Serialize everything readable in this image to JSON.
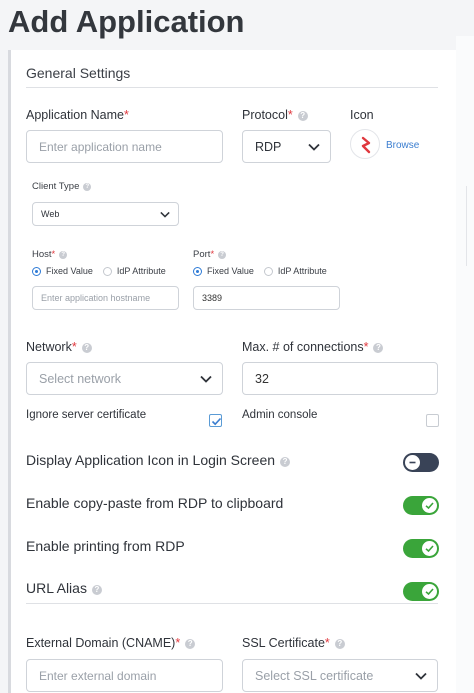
{
  "page": {
    "title": "Add Application"
  },
  "section": {
    "title": "General Settings"
  },
  "app_name": {
    "label": "Application Name",
    "placeholder": "Enter application name"
  },
  "protocol": {
    "label": "Protocol",
    "value": "RDP"
  },
  "icon": {
    "label": "Icon",
    "browse_label": "Browse",
    "logo_color": "#e0383e"
  },
  "client_type": {
    "label": "Client Type",
    "value": "Web"
  },
  "host": {
    "label": "Host",
    "options": [
      "Fixed Value",
      "IdP Attribute"
    ],
    "selected": "Fixed Value",
    "placeholder": "Enter application hostname"
  },
  "port": {
    "label": "Port",
    "options": [
      "Fixed Value",
      "IdP Attribute"
    ],
    "selected": "Fixed Value",
    "value": "3389"
  },
  "network": {
    "label": "Network",
    "placeholder": "Select network"
  },
  "max_connections": {
    "label": "Max. # of connections",
    "value": "32"
  },
  "ignore_cert": {
    "label": "Ignore server certificate",
    "checked": true
  },
  "admin_console": {
    "label": "Admin console",
    "checked": false
  },
  "toggles": {
    "display_icon": {
      "label": "Display Application Icon in Login Screen",
      "on": false
    },
    "copy_paste": {
      "label": "Enable copy-paste from RDP to clipboard",
      "on": true
    },
    "printing": {
      "label": "Enable printing from RDP",
      "on": true
    },
    "url_alias": {
      "label": "URL Alias",
      "on": true
    }
  },
  "external_domain": {
    "label": "External Domain (CNAME)",
    "placeholder": "Enter external domain"
  },
  "ssl_cert": {
    "label": "SSL Certificate",
    "placeholder": "Select SSL certificate"
  },
  "colors": {
    "accent": "#3b7ed0",
    "toggle_on": "#3aa53a",
    "toggle_off": "#394357",
    "required": "#e0383e"
  }
}
